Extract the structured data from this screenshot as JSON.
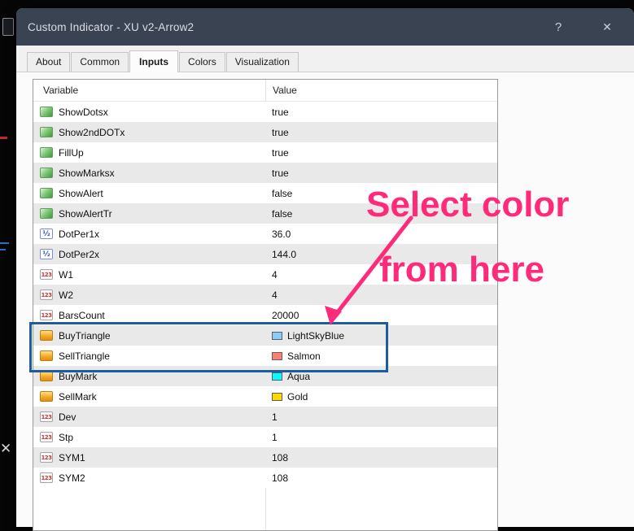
{
  "window": {
    "title": "Custom Indicator - XU v2-Arrow2",
    "help_label": "?",
    "close_label": "✕"
  },
  "background": {
    "close_glyph": "✕"
  },
  "tabs": [
    {
      "label": "About",
      "active": false
    },
    {
      "label": "Common",
      "active": false
    },
    {
      "label": "Inputs",
      "active": true
    },
    {
      "label": "Colors",
      "active": false
    },
    {
      "label": "Visualization",
      "active": false
    }
  ],
  "icons": {
    "bool-icon": "",
    "fraction-icon": "½",
    "number-icon": "123",
    "color-icon": ""
  },
  "table": {
    "headers": [
      "Variable",
      "Value"
    ],
    "rows": [
      {
        "icon": "bool-icon",
        "variable": "ShowDotsx",
        "value": "true",
        "swatch": null
      },
      {
        "icon": "bool-icon",
        "variable": "Show2ndDOTx",
        "value": "true",
        "swatch": null
      },
      {
        "icon": "bool-icon",
        "variable": "FillUp",
        "value": "true",
        "swatch": null
      },
      {
        "icon": "bool-icon",
        "variable": "ShowMarksx",
        "value": "true",
        "swatch": null
      },
      {
        "icon": "bool-icon",
        "variable": "ShowAlert",
        "value": "false",
        "swatch": null
      },
      {
        "icon": "bool-icon",
        "variable": "ShowAlertTr",
        "value": "false",
        "swatch": null
      },
      {
        "icon": "fraction-icon",
        "variable": "DotPer1x",
        "value": "36.0",
        "swatch": null
      },
      {
        "icon": "fraction-icon",
        "variable": "DotPer2x",
        "value": "144.0",
        "swatch": null
      },
      {
        "icon": "number-icon",
        "variable": "W1",
        "value": "4",
        "swatch": null
      },
      {
        "icon": "number-icon",
        "variable": "W2",
        "value": "4",
        "swatch": null
      },
      {
        "icon": "number-icon",
        "variable": "BarsCount",
        "value": "20000",
        "swatch": null
      },
      {
        "icon": "color-icon",
        "variable": "BuyTriangle",
        "value": "LightSkyBlue",
        "swatch": "#87CEFA"
      },
      {
        "icon": "color-icon",
        "variable": "SellTriangle",
        "value": "Salmon",
        "swatch": "#FA8072"
      },
      {
        "icon": "color-icon",
        "variable": "BuyMark",
        "value": "Aqua",
        "swatch": "#00FFFF"
      },
      {
        "icon": "color-icon",
        "variable": "SellMark",
        "value": "Gold",
        "swatch": "#FFD700"
      },
      {
        "icon": "number-icon",
        "variable": "Dev",
        "value": "1",
        "swatch": null
      },
      {
        "icon": "number-icon",
        "variable": "Stp",
        "value": "1",
        "swatch": null
      },
      {
        "icon": "number-icon",
        "variable": "SYM1",
        "value": "108",
        "swatch": null
      },
      {
        "icon": "number-icon",
        "variable": "SYM2",
        "value": "108",
        "swatch": null
      }
    ]
  },
  "annotation": {
    "line1": "Select color",
    "line2": "from here",
    "color": "#ff2b7a"
  },
  "highlight": {
    "color": "#1d5c9f"
  }
}
